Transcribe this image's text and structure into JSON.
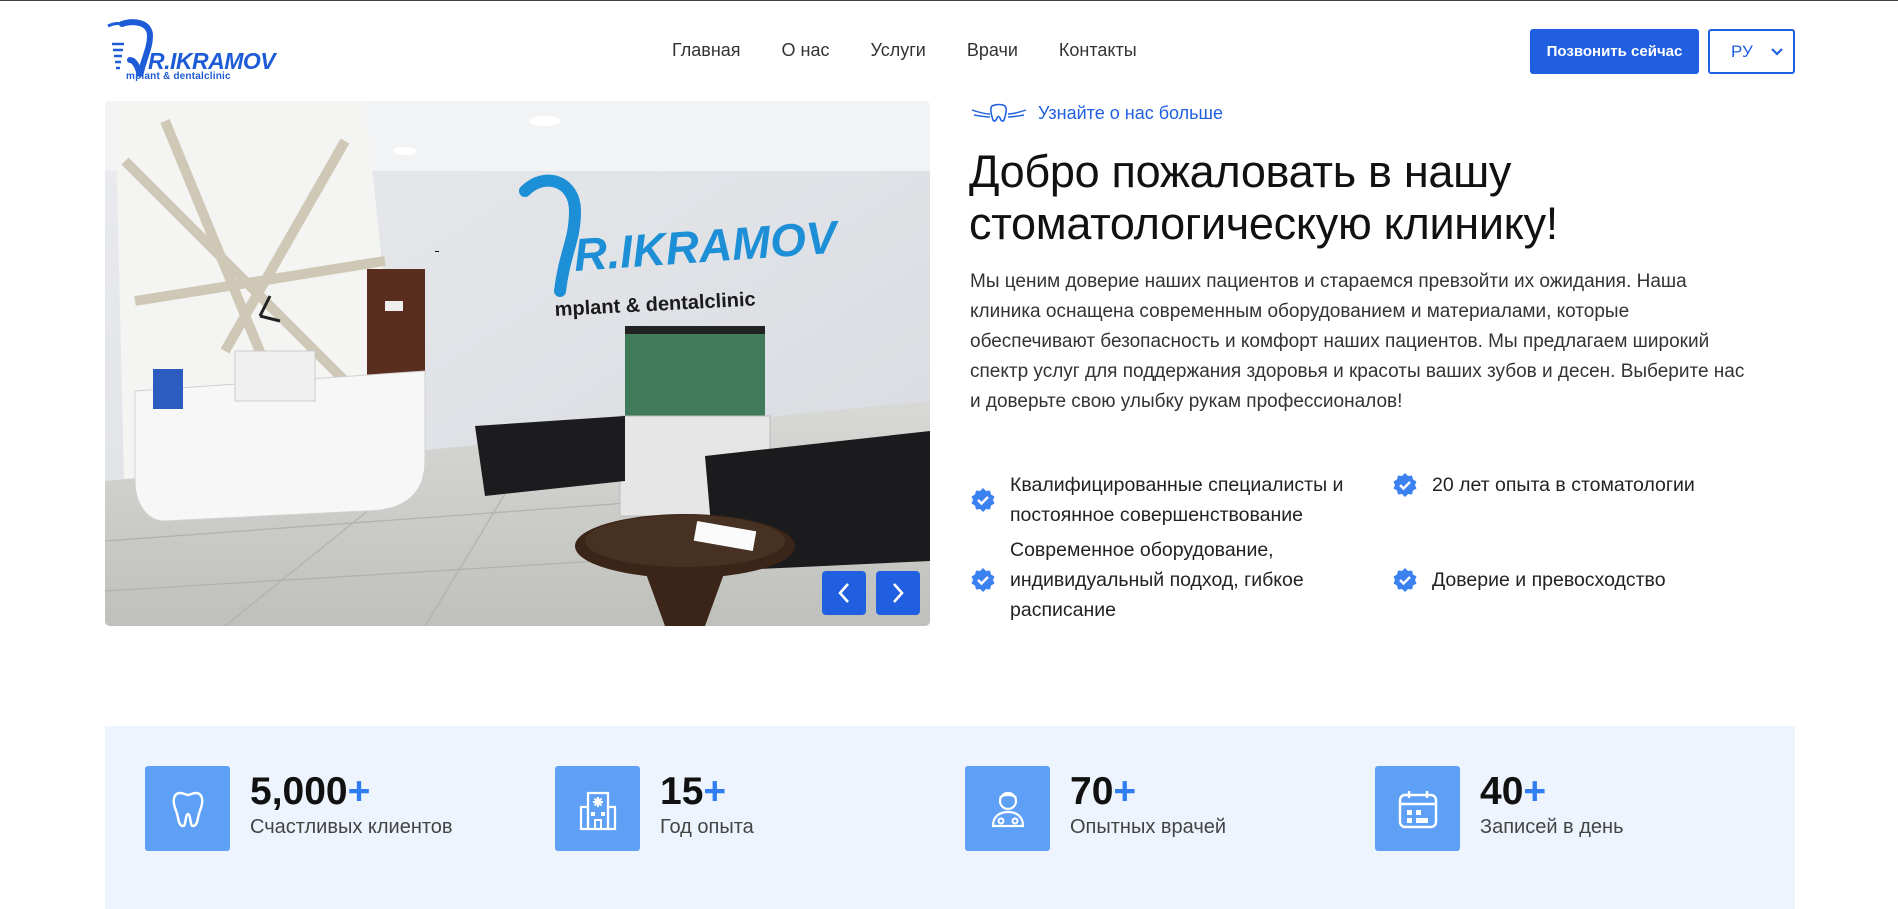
{
  "header": {
    "logo_text": "R.IKRAMOV",
    "logo_sub": "mplant & dentalclinic",
    "nav": [
      "Главная",
      "О нас",
      "Услуги",
      "Врачи",
      "Контакты"
    ],
    "call_button": "Позвонить сейчас",
    "language": "РУ"
  },
  "hero": {
    "sign_text": "R.IKRAMOV",
    "sign_sub": "mplant & dentalclinic"
  },
  "about": {
    "kicker": "Узнайте о нас больше",
    "title": "Добро пожаловать в нашу стоматологическую клинику!",
    "description": "Мы ценим доверие наших пациентов и стараемся превзойти их ожидания. Наша клиника оснащена современным оборудованием и материалами, которые обеспечивают безопасность и комфорт наших пациентов. Мы предлагаем широкий спектр услуг для поддержания здоровья и красоты ваших зубов и десен. Выберите нас и доверьте свою улыбку рукам профессионалов!",
    "features": [
      "Квалифицированные специалисты и постоянное совершенствование",
      "20 лет опыта в стоматологии",
      "Современное оборудование, индивидуальный подход, гибкое расписание",
      "Доверие и превосходство"
    ]
  },
  "stats": [
    {
      "icon": "tooth-icon",
      "value": "5,000",
      "suffix": "+",
      "label": "Счастливых клиентов"
    },
    {
      "icon": "hospital-icon",
      "value": "15",
      "suffix": "+",
      "label": "Год опыта"
    },
    {
      "icon": "doctor-icon",
      "value": "70",
      "suffix": "+",
      "label": "Опытных врачей"
    },
    {
      "icon": "calendar-icon",
      "value": "40",
      "suffix": "+",
      "label": "Записей в день"
    }
  ],
  "colors": {
    "accent": "#1f5fe0",
    "stat_icon_bg": "#5ea0f5",
    "stats_bg": "#edf4fd"
  }
}
